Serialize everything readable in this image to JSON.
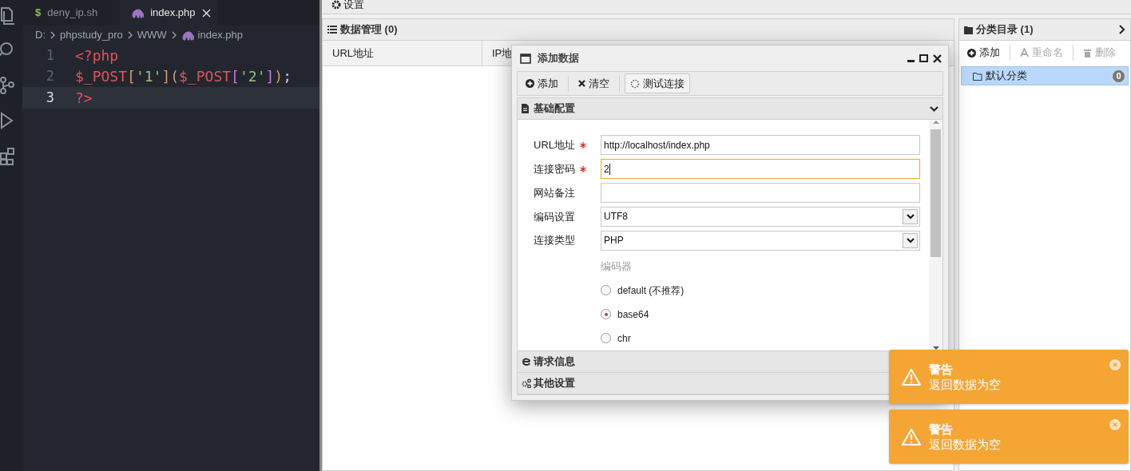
{
  "editor": {
    "tabs": [
      {
        "label": "deny_ip.sh",
        "kind": "shell",
        "glyph": "$",
        "selected": false
      },
      {
        "label": "index.php",
        "kind": "php",
        "selected": true
      }
    ],
    "breadcrumb": [
      {
        "label": "D:",
        "kind": "text"
      },
      {
        "label": "phpstudy_pro",
        "kind": "text"
      },
      {
        "label": "WWW",
        "kind": "text"
      },
      {
        "label": "index.php",
        "kind": "php"
      }
    ],
    "lines": [
      {
        "number": "1",
        "current": false,
        "tokens": [
          {
            "text": "<?php",
            "kind": "keyword"
          }
        ]
      },
      {
        "number": "2",
        "current": false,
        "tokens": [
          {
            "text": "$_POST",
            "kind": "keyword"
          },
          {
            "text": "[",
            "kind": "bracket1"
          },
          {
            "text": "'1'",
            "kind": "string"
          },
          {
            "text": "]",
            "kind": "bracket1"
          },
          {
            "text": "(",
            "kind": "bracket1"
          },
          {
            "text": "$_POST",
            "kind": "keyword"
          },
          {
            "text": "[",
            "kind": "bracket2"
          },
          {
            "text": "'2'",
            "kind": "string"
          },
          {
            "text": "]",
            "kind": "bracket2"
          },
          {
            "text": ")",
            "kind": "bracket1"
          },
          {
            "text": ";",
            "kind": "punct"
          }
        ]
      },
      {
        "number": "3",
        "current": true,
        "tokens": [
          {
            "text": "?>",
            "kind": "keyword"
          }
        ]
      }
    ]
  },
  "app": {
    "settings_bar": "设置",
    "data_panel": {
      "title": "数据管理 (0)",
      "columns": [
        "URL地址",
        "IP地"
      ]
    },
    "category_panel": {
      "title": "分类目录 (1)",
      "toolbar": [
        {
          "label": "添加",
          "kind": "add",
          "disabled": false
        },
        {
          "label": "重命名",
          "kind": "rename",
          "disabled": true
        },
        {
          "label": "删除",
          "kind": "delete",
          "disabled": true
        }
      ],
      "items": [
        {
          "label": "默认分类",
          "count": "0",
          "selected": true
        }
      ]
    }
  },
  "dialog": {
    "title": "添加数据",
    "toolbar": [
      {
        "label": "添加",
        "kind": "add"
      },
      {
        "label": "清空",
        "kind": "clear"
      },
      {
        "label": "测试连接",
        "kind": "test"
      }
    ],
    "sections": [
      {
        "title": "基础配置",
        "kind": "doc",
        "expanded": true
      },
      {
        "title": "请求信息",
        "kind": "browser",
        "expanded": false
      },
      {
        "title": "其他设置",
        "kind": "gears",
        "expanded": false
      }
    ],
    "fields": [
      {
        "label": "URL地址",
        "kind": "text",
        "required": true,
        "focused": false,
        "value": "http://localhost/index.php"
      },
      {
        "label": "连接密码",
        "kind": "text",
        "required": true,
        "focused": true,
        "value": "2"
      },
      {
        "label": "网站备注",
        "kind": "text",
        "required": false,
        "focused": false
      },
      {
        "label": "编码设置",
        "kind": "select",
        "required": false,
        "focused": false,
        "value": "UTF8"
      },
      {
        "label": "连接类型",
        "kind": "select",
        "required": false,
        "focused": false,
        "value": "PHP"
      }
    ],
    "encoder": {
      "label": "编码器",
      "options": [
        {
          "label": "default (不推荐)",
          "selected": false
        },
        {
          "label": "base64",
          "selected": true
        },
        {
          "label": "chr",
          "selected": false
        }
      ]
    }
  },
  "toasts": [
    {
      "title": "警告",
      "message": "返回数据为空"
    },
    {
      "title": "警告",
      "message": "返回数据为空"
    }
  ]
}
